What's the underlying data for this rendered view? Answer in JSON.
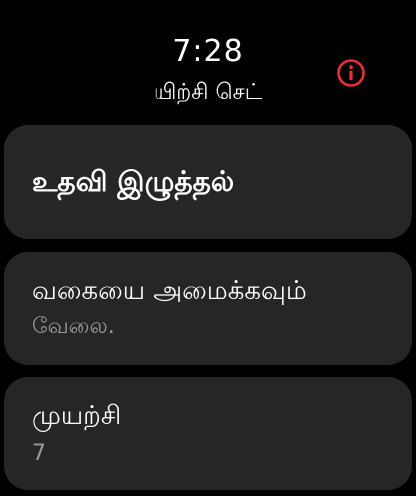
{
  "status": {
    "time": "7:28"
  },
  "header": {
    "title": "யிற்சி செட்",
    "info_icon": "info-icon",
    "accent_color": "#e5303b"
  },
  "cards": {
    "help_pull": {
      "label": "உதவி இழுத்தல்"
    },
    "set_type": {
      "label": "வகையை அமைக்கவும்",
      "value": "வேலை."
    },
    "attempt": {
      "label": "முயற்சி",
      "value": "7"
    }
  }
}
